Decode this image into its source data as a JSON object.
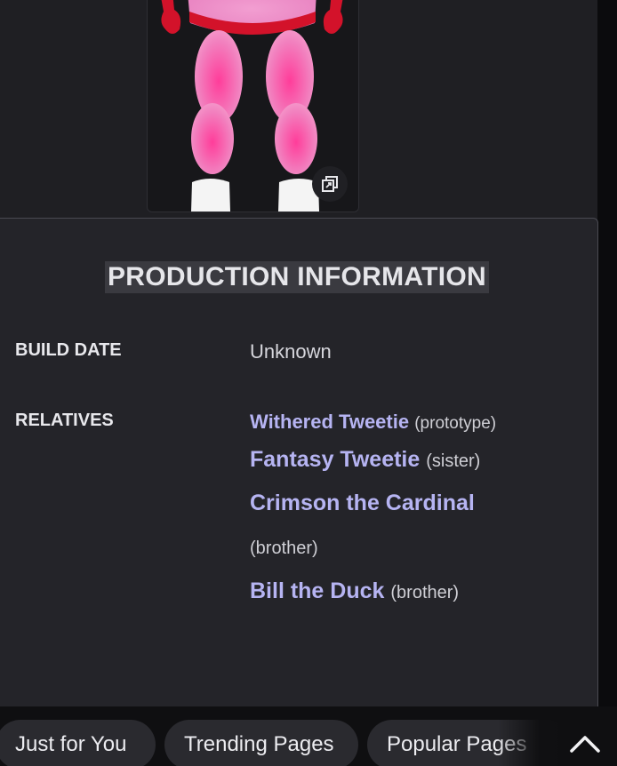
{
  "infobox": {
    "section_title": "PRODUCTION INFORMATION",
    "build_date_label": "BUILD DATE",
    "build_date_value": "Unknown",
    "relatives_label": "RELATIVES",
    "relatives": [
      {
        "name": "Withered Tweetie",
        "note": "(prototype)"
      },
      {
        "name": "Fantasy Tweetie",
        "note": "(sister)"
      },
      {
        "name": "Crimson the Cardinal",
        "note": "(brother)"
      },
      {
        "name": "Bill the Duck",
        "note": "(brother)"
      }
    ]
  },
  "figure": {
    "expand_icon": "expand-icon",
    "colors": {
      "body": "#f06bb4",
      "trim": "#d3122a",
      "shoes": "#f4f4f4"
    }
  },
  "bottom_nav": {
    "items": [
      "Just for You",
      "Trending Pages",
      "Popular Pages"
    ],
    "scroll_top_icon": "chevron-up-icon"
  },
  "colors": {
    "link": "#b6b4f2",
    "background": "#1f1f23",
    "panel": "#242429"
  }
}
